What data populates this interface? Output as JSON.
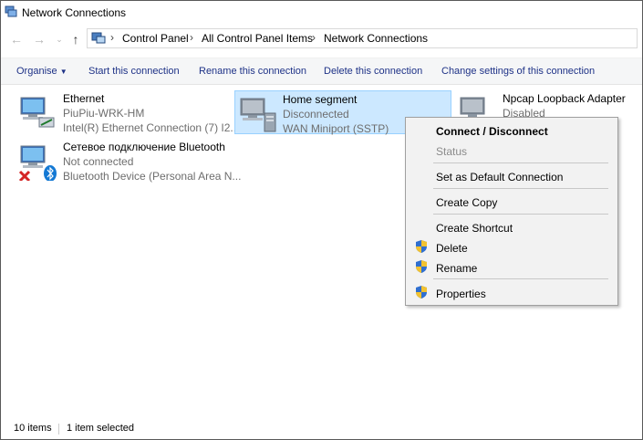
{
  "window": {
    "title": "Network Connections"
  },
  "address": {
    "crumbs": [
      "Control Panel",
      "All Control Panel Items",
      "Network Connections"
    ]
  },
  "toolbar": {
    "organise": "Organise",
    "start": "Start this connection",
    "rename": "Rename this connection",
    "delete": "Delete this connection",
    "change_settings": "Change settings of this connection"
  },
  "connections": [
    {
      "name": "Ethernet",
      "status": "PiuPiu-WRK-HM",
      "device": "Intel(R) Ethernet Connection (7) I2..."
    },
    {
      "name": "Home segment",
      "status": "Disconnected",
      "device": "WAN Miniport (SSTP)"
    },
    {
      "name": "Npcap Loopback Adapter",
      "status": "Disabled",
      "device": ""
    },
    {
      "name": "Сетевое подключение Bluetooth",
      "status": "Not connected",
      "device": "Bluetooth Device (Personal Area N..."
    }
  ],
  "context_menu": {
    "connect": "Connect / Disconnect",
    "status": "Status",
    "set_default": "Set as Default Connection",
    "create_copy": "Create Copy",
    "create_shortcut": "Create Shortcut",
    "delete": "Delete",
    "rename": "Rename",
    "properties": "Properties"
  },
  "statusbar": {
    "count": "10 items",
    "selected": "1 item selected"
  },
  "colors": {
    "selection": "#cce8ff",
    "command_text": "#1e3287",
    "menu_bg": "#f2f2f2"
  }
}
